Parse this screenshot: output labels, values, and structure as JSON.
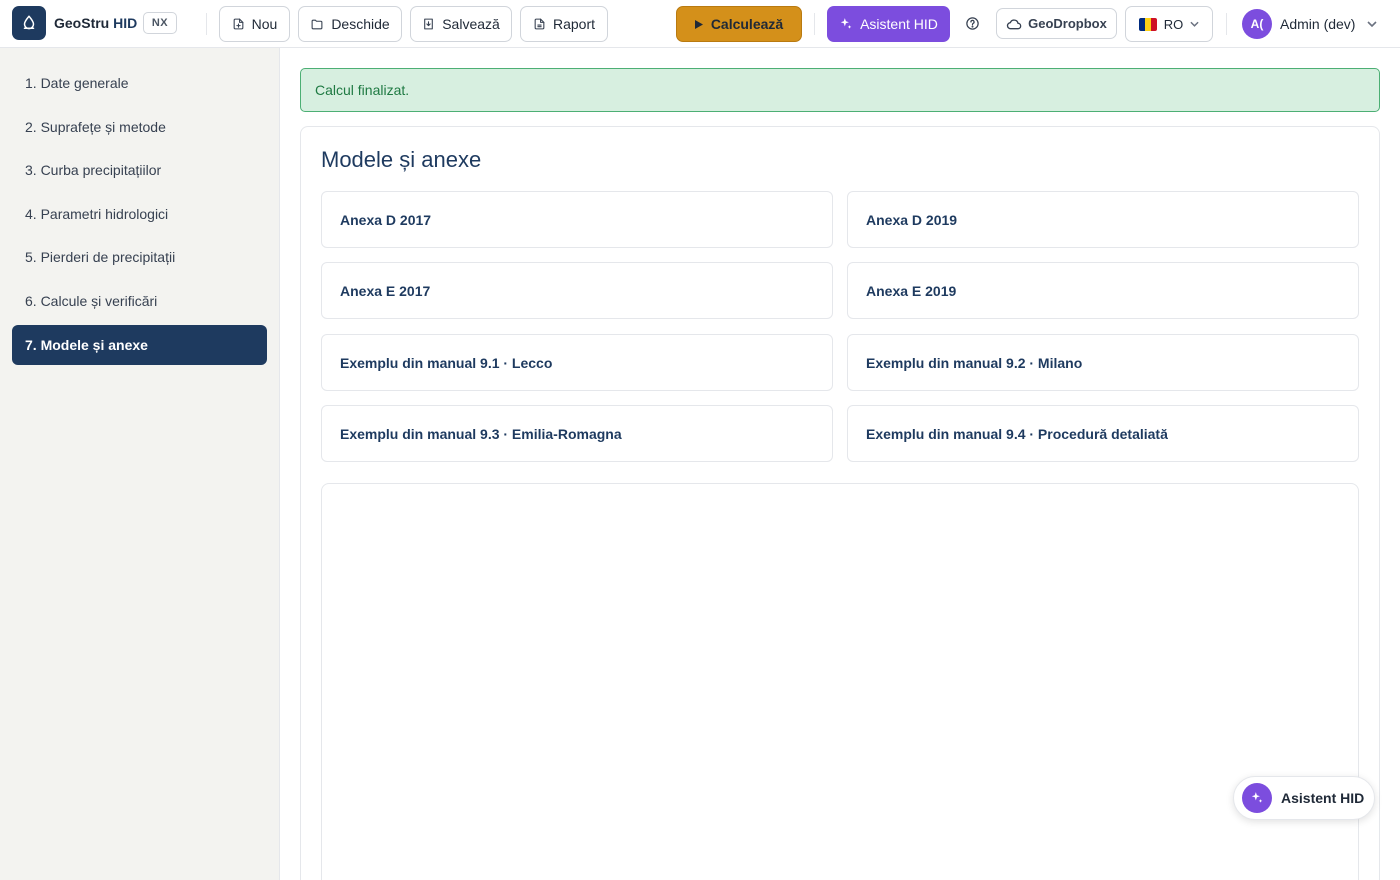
{
  "header": {
    "app_name": "GeoStru",
    "app_name_accent": "HID",
    "badge": "NX",
    "toolbar": {
      "new_label": "Nou",
      "open_label": "Deschide",
      "save_label": "Salvează",
      "report_label": "Raport"
    },
    "calculate_label": "Calculează",
    "assistant_label": "Asistent HID",
    "geodropbox_label": "GeoDropbox",
    "language_label": "RO",
    "user": {
      "avatar_initials": "A(",
      "name": "Admin (dev)"
    }
  },
  "sidebar": {
    "items": [
      {
        "label": "1. Date generale"
      },
      {
        "label": "2. Suprafețe și metode"
      },
      {
        "label": "3. Curba precipitațiilor"
      },
      {
        "label": "4. Parametri hidrologici"
      },
      {
        "label": "5. Pierderi de precipitații"
      },
      {
        "label": "6. Calcule și verificări"
      },
      {
        "label": "7. Modele și anexe"
      }
    ],
    "active_index": 6
  },
  "main": {
    "alert": "Calcul finalizat.",
    "title": "Modele și anexe",
    "cards": [
      {
        "label": "Anexa D 2017"
      },
      {
        "label": "Anexa D 2019"
      },
      {
        "label": "Anexa E 2017"
      },
      {
        "label": "Anexa E 2019"
      },
      {
        "label": "Exemplu din manual 9.1 · Lecco"
      },
      {
        "label": "Exemplu din manual 9.2 · Milano"
      },
      {
        "label": "Exemplu din manual 9.3 · Emilia-Romagna"
      },
      {
        "label": "Exemplu din manual 9.4 · Procedură detaliată"
      }
    ]
  },
  "floating_assistant_label": "Asistent HID",
  "colors": {
    "primary": "#1e3a5f",
    "calculate": "#d4901a",
    "assistant": "#7c4dde",
    "success_bg": "#d7efe0",
    "success_text": "#1f7a43"
  }
}
